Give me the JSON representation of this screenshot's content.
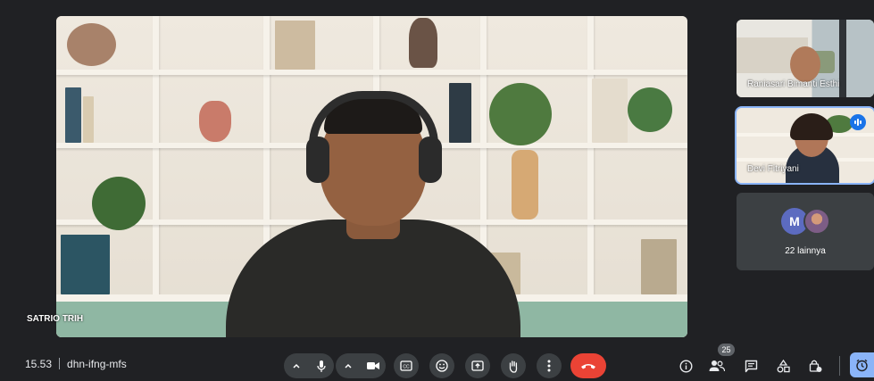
{
  "main": {
    "speaker_name": "SATRIO TRIH"
  },
  "tiles": [
    {
      "name": "Raniasari Bimanti Esthi"
    },
    {
      "name": "Devi Fitriyani"
    }
  ],
  "others": {
    "avatar_letter": "M",
    "label": "22 lainnya"
  },
  "bottom_bar": {
    "time": "15.53",
    "meeting_code": "dhn-ifng-mfs",
    "participants_count": "25"
  },
  "icons": {
    "mic": "mic-icon",
    "camera": "camera-icon",
    "captions": "captions-icon",
    "emoji": "emoji-icon",
    "present": "present-icon",
    "hand": "raise-hand-icon",
    "more": "more-options-icon",
    "end": "end-call-icon",
    "info": "info-icon",
    "people": "people-icon",
    "chat": "chat-icon",
    "activities": "activities-icon",
    "host": "host-controls-icon",
    "timer": "timer-icon"
  },
  "colors": {
    "background": "#202124",
    "end_call": "#ea4335",
    "accent": "#8ab4f8"
  }
}
